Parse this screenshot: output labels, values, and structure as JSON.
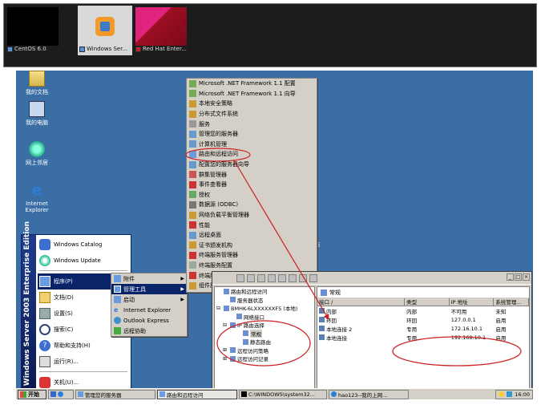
{
  "vm_tabs": [
    {
      "label": "CentOS 6.0",
      "active": false,
      "screen_color": "#000000"
    },
    {
      "label": "Windows Ser...",
      "active": true,
      "screen_color": "#d9d9d9"
    },
    {
      "label": "Red Hat Enter...",
      "active": false,
      "screen_color": "#b0102a"
    }
  ],
  "desktop_icons": [
    {
      "label": "我的文档",
      "icon": "my-documents-icon"
    },
    {
      "label": "我的电脑",
      "icon": "my-computer-icon"
    },
    {
      "label": "网上邻居",
      "icon": "network-places-icon"
    },
    {
      "label": "Internet Explorer",
      "icon": "internet-explorer-icon"
    }
  ],
  "desktop_partial_label": "站",
  "start_menu": {
    "banner": "Windows Server 2003 Enterprise Edition",
    "pinned": [
      {
        "label": "Windows Catalog",
        "icon": "windows-catalog-icon"
      },
      {
        "label": "Windows Update",
        "icon": "windows-update-icon"
      }
    ],
    "items": [
      {
        "label": "程序(P)",
        "icon": "programs-icon",
        "arrow": "▶",
        "selected": true
      },
      {
        "label": "文档(D)",
        "icon": "documents-icon",
        "arrow": "▶",
        "selected": false
      },
      {
        "label": "设置(S)",
        "icon": "settings-icon",
        "arrow": "▶",
        "selected": false
      },
      {
        "label": "搜索(C)",
        "icon": "search-icon",
        "arrow": "▶",
        "selected": false
      },
      {
        "label": "帮助和支持(H)",
        "icon": "help-icon",
        "arrow": "",
        "selected": false
      },
      {
        "label": "运行(R)...",
        "icon": "run-icon",
        "arrow": "",
        "selected": false
      }
    ],
    "shutdown": {
      "label": "关机(U)...",
      "icon": "shutdown-icon"
    }
  },
  "programs_menu": [
    {
      "label": "附件",
      "arrow": "▶",
      "selected": false
    },
    {
      "label": "管理工具",
      "arrow": "▶",
      "selected": true
    },
    {
      "label": "启动",
      "arrow": "▶",
      "selected": false
    },
    {
      "label": "Internet Explorer",
      "arrow": "",
      "selected": false
    },
    {
      "label": "Outlook Express",
      "arrow": "",
      "selected": false
    },
    {
      "label": "远程协助",
      "arrow": "",
      "selected": false
    }
  ],
  "admin_tools": [
    "Microsoft .NET Framework 1.1 配置",
    "Microsoft .NET Framework 1.1 向导",
    "本地安全策略",
    "分布式文件系统",
    "服务",
    "管理您的服务器",
    "计算机管理",
    "路由和远程访问",
    "配置您的服务器向导",
    "群集管理器",
    "事件查看器",
    "授权",
    "数据源 (ODBC)",
    "网络负载平衡管理器",
    "性能",
    "远程桌面",
    "证书颁发机构",
    "终端服务管理器",
    "终端服务配置",
    "终端服务器授权",
    "组件服务"
  ],
  "mmc": {
    "tree": [
      {
        "label": "路由和远程访问",
        "indent": 0,
        "expander": ""
      },
      {
        "label": "服务器状态",
        "indent": 1,
        "expander": ""
      },
      {
        "label": "BMHK-6LXXXXXXF5 (本地)",
        "indent": 0,
        "expander": "⊟"
      },
      {
        "label": "网络接口",
        "indent": 2,
        "expander": ""
      },
      {
        "label": "IP 路由选择",
        "indent": 1,
        "expander": "⊟"
      },
      {
        "label": "常规",
        "indent": 3,
        "expander": "",
        "highlight": true
      },
      {
        "label": "静态路由",
        "indent": 3,
        "expander": ""
      },
      {
        "label": "远程访问策略",
        "indent": 1,
        "expander": "⊞"
      },
      {
        "label": "远程访问记录",
        "indent": 1,
        "expander": "⊞"
      }
    ],
    "detail_title": "常规",
    "columns": [
      "接口 /",
      "类型",
      "IP 地址",
      "系统管理..."
    ],
    "rows": [
      [
        "内部",
        "内部",
        "不可用",
        "未知"
      ],
      [
        "环回",
        "环回",
        "127.0.0.1",
        "启用"
      ],
      [
        "本地连接 2",
        "专用",
        "172.16.10.1",
        "启用"
      ],
      [
        "本地连接",
        "专用",
        "192.168.10.1",
        "启用"
      ]
    ]
  },
  "taskbar": {
    "start_label": "开始",
    "tasks": [
      {
        "label": "管理您的服务器",
        "active": false
      },
      {
        "label": "路由和远程访问",
        "active": true
      },
      {
        "label": "C:\\WINDOWS\\system32...",
        "active": false
      },
      {
        "label": "hao123--我的上网...",
        "active": false
      }
    ],
    "clock": "16:00"
  },
  "annotation_color": "#cc1f1f"
}
